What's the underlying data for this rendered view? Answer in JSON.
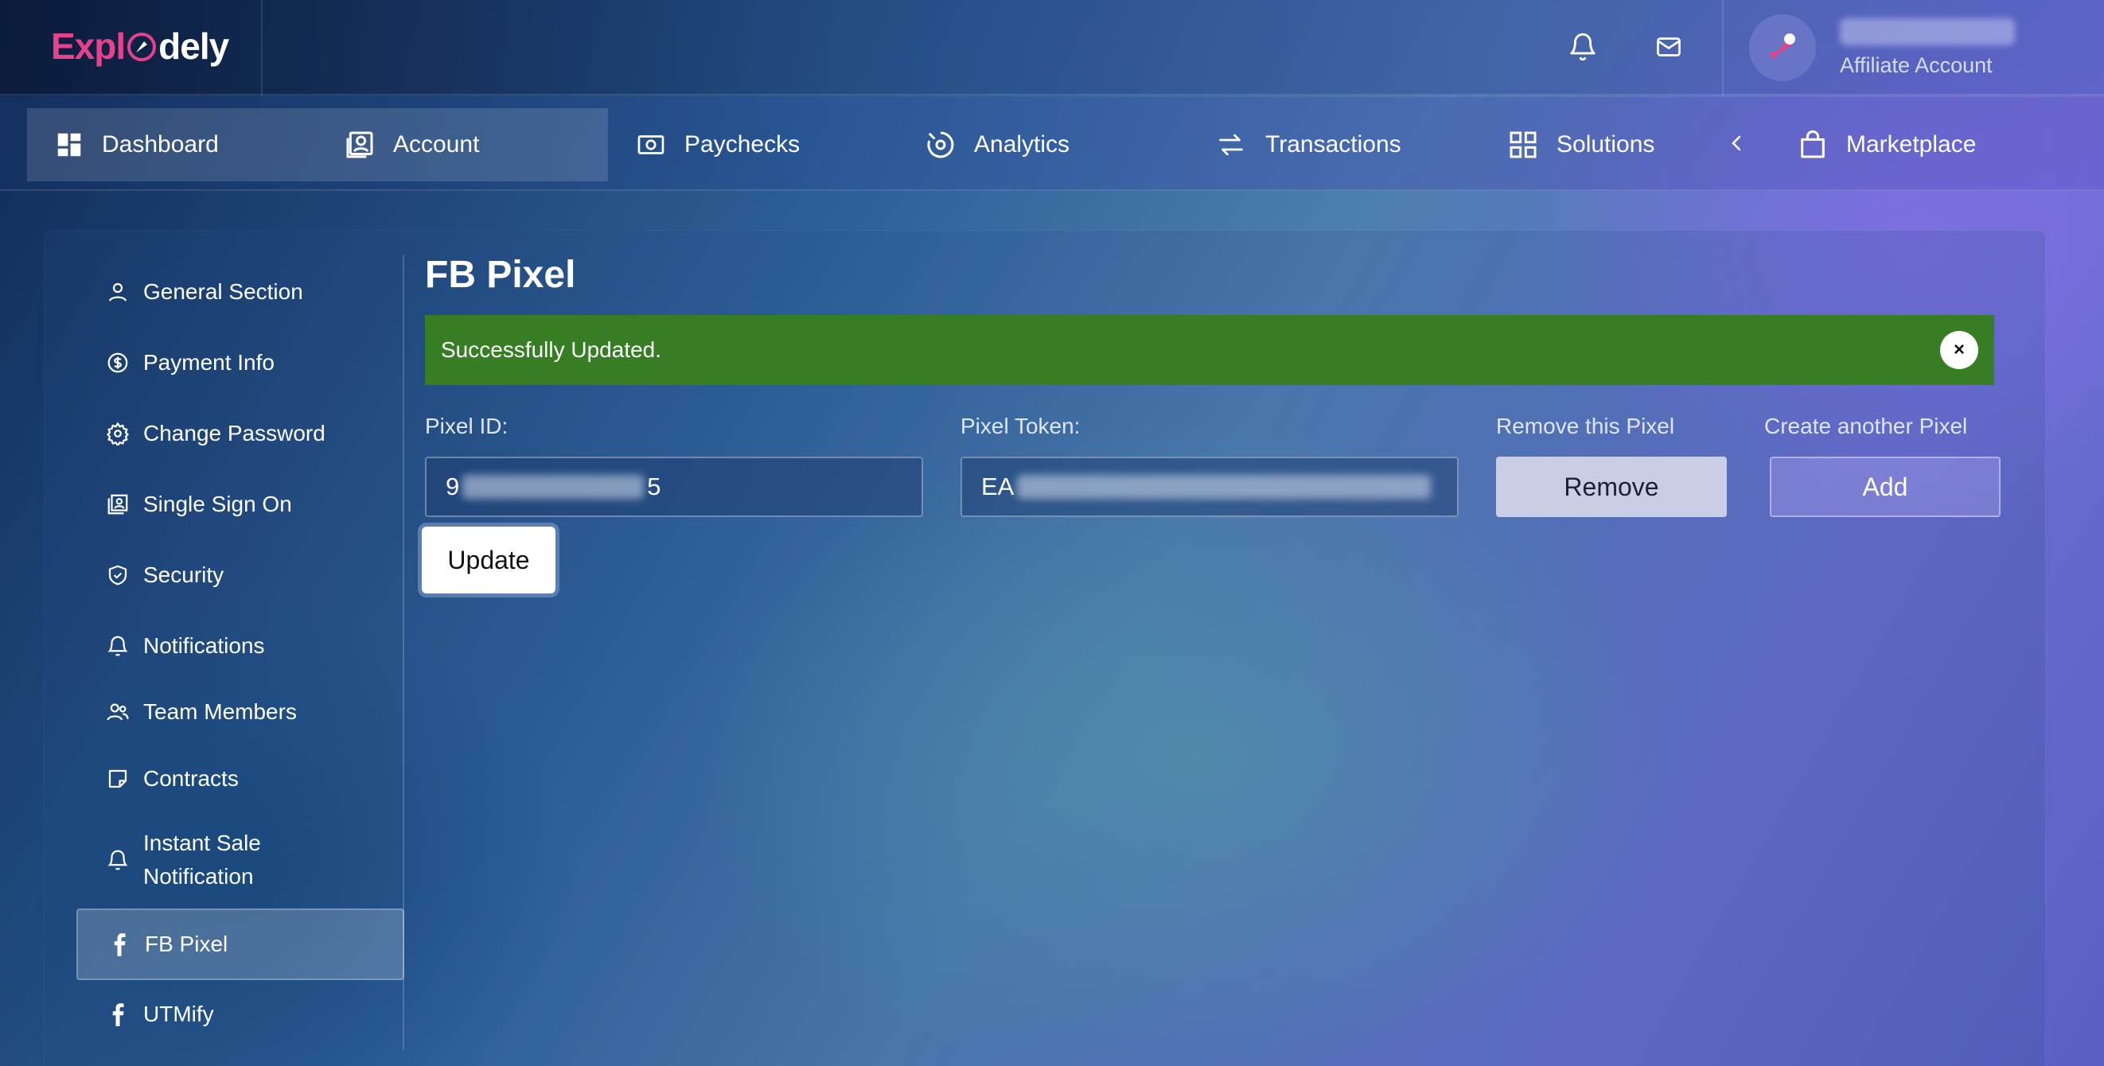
{
  "app": {
    "logo_part1": "Expl",
    "logo_part2": "dely",
    "account_type": "Affiliate Account"
  },
  "nav": {
    "items": [
      {
        "label": "Dashboard",
        "icon": "dashboard-icon"
      },
      {
        "label": "Account",
        "icon": "account-icon"
      },
      {
        "label": "Paychecks",
        "icon": "paychecks-icon"
      },
      {
        "label": "Analytics",
        "icon": "analytics-icon"
      },
      {
        "label": "Transactions",
        "icon": "transactions-icon"
      },
      {
        "label": "Solutions",
        "icon": "solutions-icon"
      },
      {
        "label": "Marketplace",
        "icon": "marketplace-icon"
      }
    ]
  },
  "sidebar": {
    "items": [
      {
        "label": "General Section",
        "icon": "user-icon"
      },
      {
        "label": "Payment Info",
        "icon": "dollar-circle-icon"
      },
      {
        "label": "Change Password",
        "icon": "gear-icon"
      },
      {
        "label": "Single Sign On",
        "icon": "id-card-icon"
      },
      {
        "label": "Security",
        "icon": "shield-icon"
      },
      {
        "label": "Notifications",
        "icon": "bell-icon"
      },
      {
        "label": "Team Members",
        "icon": "team-icon"
      },
      {
        "label": "Contracts",
        "icon": "note-icon"
      },
      {
        "label": "Instant Sale Notification",
        "icon": "bell-icon"
      },
      {
        "label": "FB Pixel",
        "icon": "facebook-icon"
      },
      {
        "label": "UTMify",
        "icon": "facebook-icon"
      }
    ],
    "active": "FB Pixel"
  },
  "main": {
    "title": "FB Pixel",
    "alert": {
      "message": "Successfully Updated.",
      "close": "×"
    },
    "pixel_id": {
      "label": "Pixel ID:",
      "value_start": "9",
      "value_end": "5"
    },
    "pixel_token": {
      "label": "Pixel Token:",
      "value_start": "EA"
    },
    "remove": {
      "label": "Remove this Pixel",
      "button": "Remove"
    },
    "add": {
      "label": "Create another Pixel",
      "button": "Add"
    },
    "update_button": "Update"
  },
  "colors": {
    "alert_green": "#367d23",
    "brand_pink": "#e8408a",
    "remove_button": "#c9cde6"
  }
}
